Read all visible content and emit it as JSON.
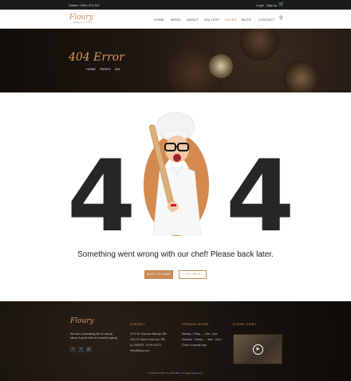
{
  "topbar": {
    "phone": "Hotline: 0904 474 627",
    "login": "Login",
    "signup": "Sign up"
  },
  "logo": {
    "text": "Floury",
    "tagline": "BAKERY & CAFE"
  },
  "nav": {
    "items": [
      {
        "label": "HOME"
      },
      {
        "label": "MENU"
      },
      {
        "label": "ABOUT"
      },
      {
        "label": "GALLERY"
      },
      {
        "label": "PAGES"
      },
      {
        "label": "BLOG"
      },
      {
        "label": "CONTACT"
      }
    ],
    "active": "PAGES"
  },
  "hero": {
    "title": "404 Error",
    "breadcrumbs": [
      "HOME",
      "PAGES",
      "404"
    ]
  },
  "error": {
    "digit_left": "4",
    "digit_right": "4",
    "message": "Something went wrong with our chef! Please back later.",
    "home_button": "BACK TO HOME",
    "help_button": "GET HELP"
  },
  "footer": {
    "logo": "Floury",
    "about": "We have a fascinating flair for various bakery & good chefs at a smooth capacity",
    "social": [
      "f",
      "t",
      "g+"
    ],
    "contact_heading": "CONTACT",
    "contact_lines": [
      "37/13 St. Revenue Wall Apt. 883",
      "1120 St. Statue Grace Apt. 990",
      "(1) 4390675 - 90 59 43 573",
      "hello@floury.com"
    ],
    "hours_heading": "OPENING HOURS",
    "hours_lines": [
      "Monday - Friday ..... 6am - 9pm",
      "Saturday - Sunday ..... 8am - 10pm",
      "Close on special days"
    ],
    "video_heading": "FLOURY VIDEO",
    "copyright": "© 2016 FLOURY by SNUGBO. All Rights Reserved."
  },
  "colors": {
    "accent": "#c98a52",
    "dark": "#262626",
    "hero_bg": "#1f1711"
  }
}
